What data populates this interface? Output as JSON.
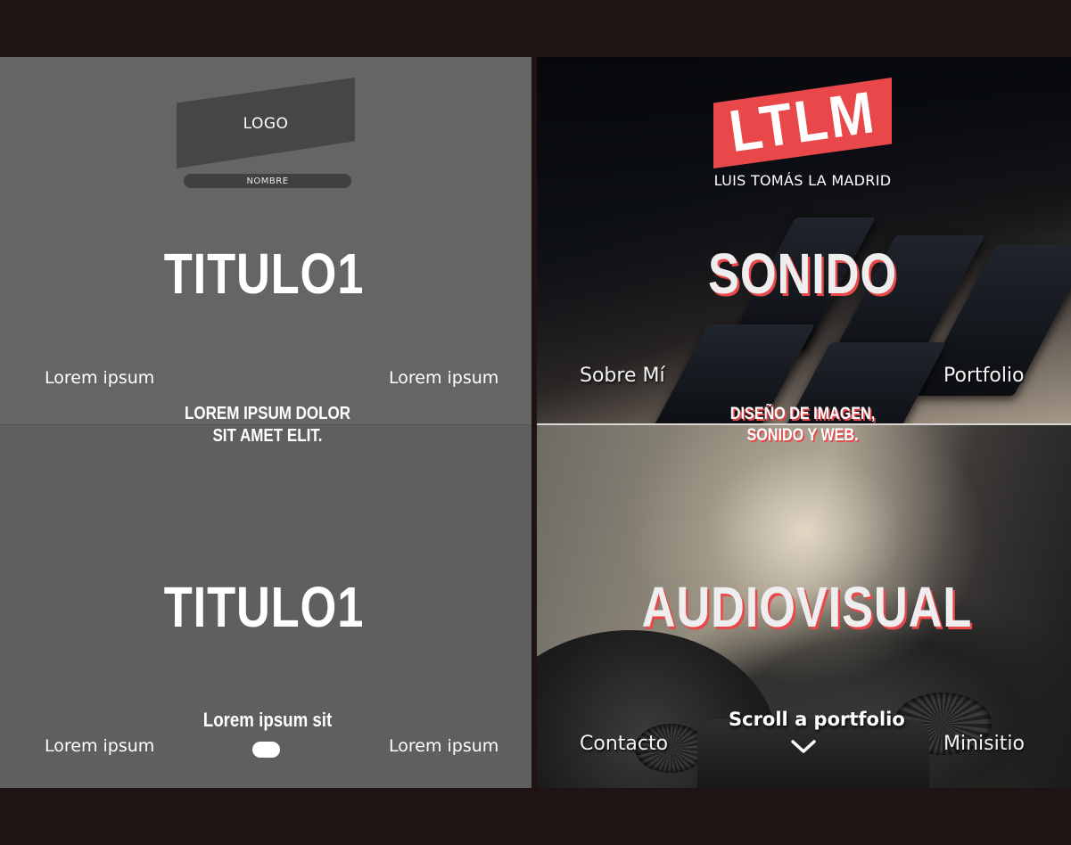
{
  "wireframe": {
    "logo_label": "LOGO",
    "name_label": "NOMBRE",
    "top": {
      "title": "TITULO1",
      "nav_left": "Lorem ipsum",
      "nav_right": "Lorem ipsum",
      "subtitle_line1": "LOREM IPSUM DOLOR",
      "subtitle_line2": "SIT AMET ELIT."
    },
    "bottom": {
      "title": "TITULO1",
      "cta_label": "Lorem ipsum sit",
      "nav_left": "Lorem ipsum",
      "nav_right": "Lorem ipsum"
    }
  },
  "design": {
    "brand_logo": "LTLM",
    "brand_name": "LUIS TOMÁS LA MADRID",
    "top": {
      "title": "SONIDO",
      "nav_left": "Sobre Mí",
      "nav_right": "Portfolio",
      "tagline_line1": "DISEÑO DE IMAGEN,",
      "tagline_line2": "SONIDO Y WEB."
    },
    "bottom": {
      "title": "AUDIOVISUAL",
      "scroll_label": "Scroll a portfolio",
      "nav_left": "Contacto",
      "nav_right": "Minisitio"
    }
  },
  "colors": {
    "frame": "#1f1313",
    "wireframe_panel": "#656565",
    "accent_red": "#e8484a"
  },
  "icons": {
    "scroll": "chevron-down-icon"
  }
}
